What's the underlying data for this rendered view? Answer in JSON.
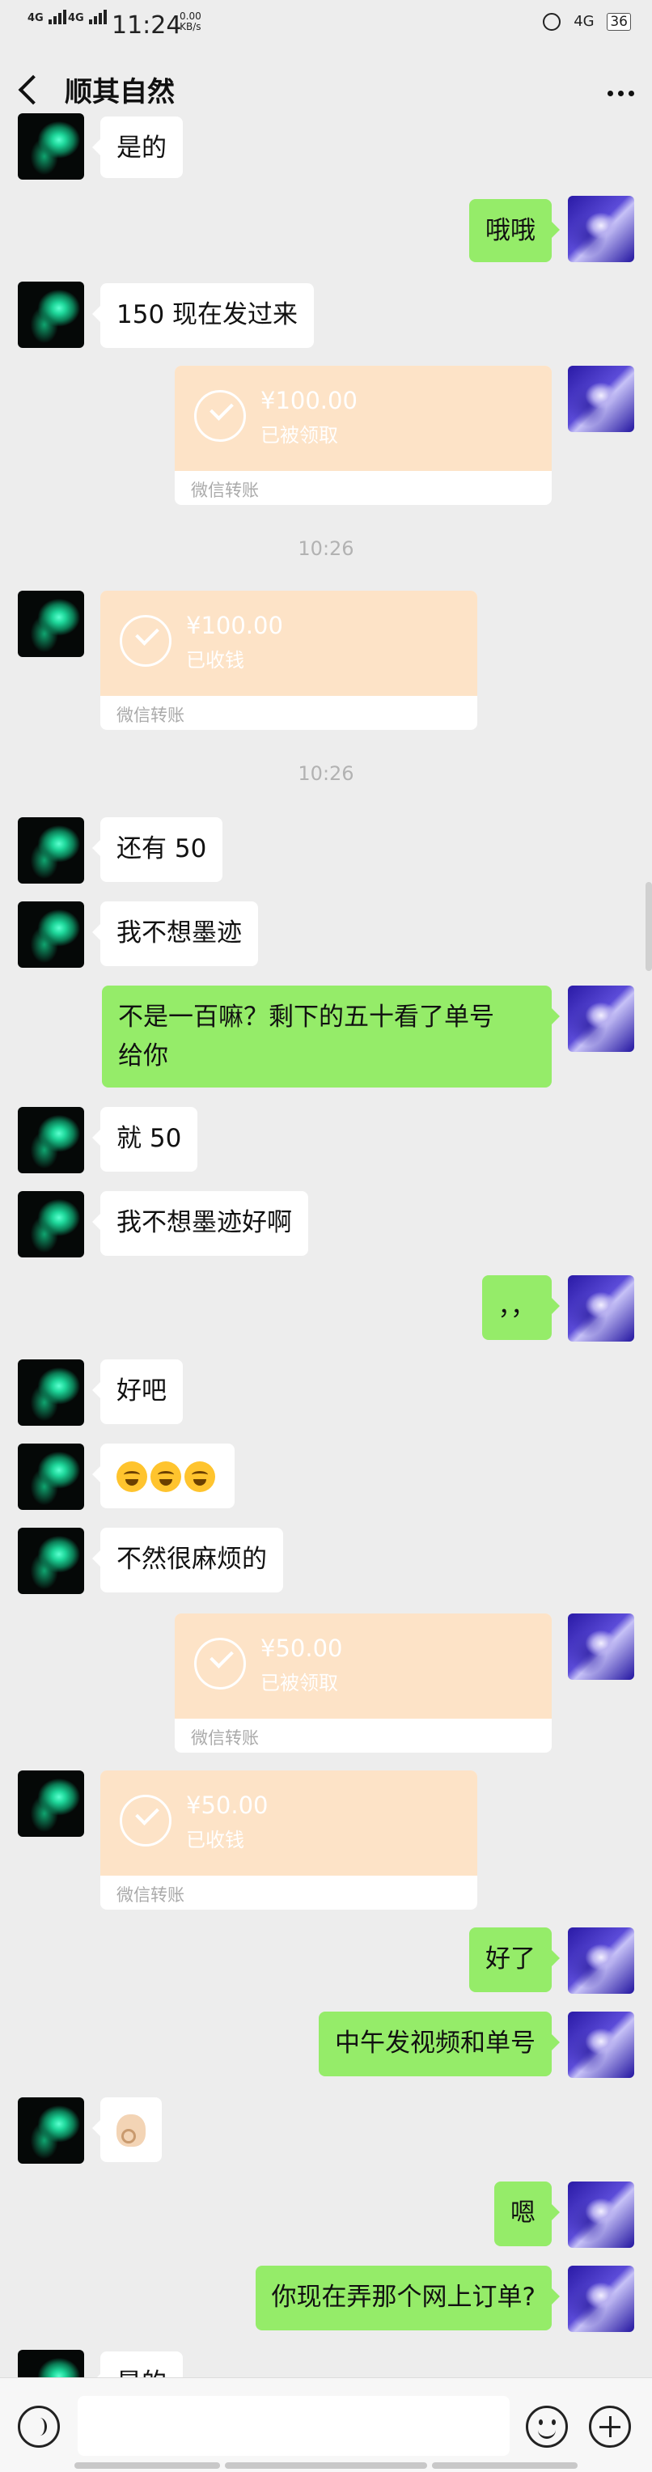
{
  "status_bar": {
    "signal_1": "4G",
    "signal_2": "4G",
    "time": "11:24",
    "speed_value": "0.00",
    "speed_unit": "KB/s",
    "network": "4G",
    "battery": "36"
  },
  "nav": {
    "title": "顺其自然"
  },
  "timestamps": [
    "10:26",
    "10:26"
  ],
  "messages": {
    "m0": "是的",
    "m1": "哦哦",
    "m2": "150 现在发过来",
    "m3": "还有 50",
    "m4": "我不想墨迹",
    "m5_line1": "不是一百嘛？剩下的五十看了单号",
    "m5_line2": "给你",
    "m6": "就 50",
    "m7": "我不想墨迹好啊",
    "m8": "，，",
    "m9": "好吧",
    "m11": "不然很麻烦的",
    "m14": "好了",
    "m15": "中午发视频和单号",
    "m17": "嗯",
    "m18": "你现在弄那个网上订单?",
    "m19": "是的"
  },
  "transfers": [
    {
      "amount": "¥100.00",
      "status": "已被领取",
      "label": "微信转账"
    },
    {
      "amount": "¥100.00",
      "status": "已收钱",
      "label": "微信转账"
    },
    {
      "amount": "¥50.00",
      "status": "已被领取",
      "label": "微信转账"
    },
    {
      "amount": "¥50.00",
      "status": "已收钱",
      "label": "微信转账"
    }
  ],
  "icons": {
    "back": "back-arrow-icon",
    "more": "more-dots-icon",
    "voice": "voice-icon",
    "emoji": "emoji-icon",
    "plus": "plus-icon"
  },
  "colors": {
    "background": "#ededed",
    "self_bubble": "#95ec69",
    "other_bubble": "#ffffff",
    "transfer": "#fde3c7"
  }
}
